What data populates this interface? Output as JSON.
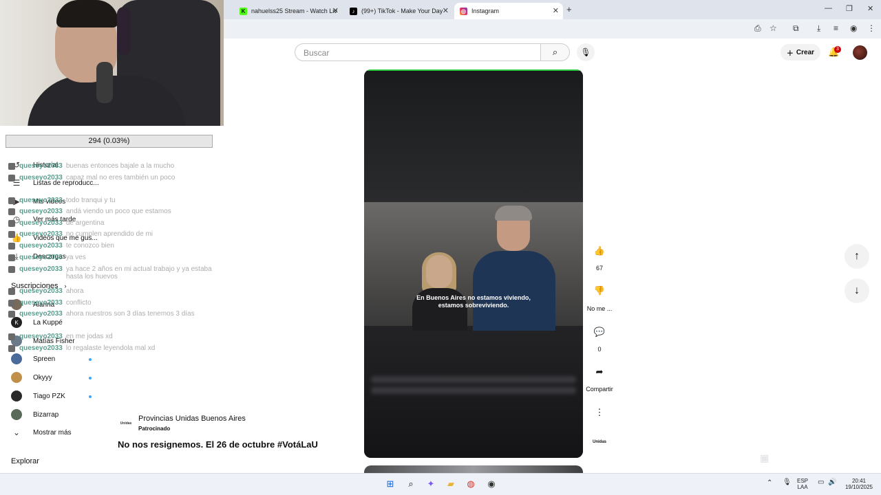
{
  "browser": {
    "tabs": [
      {
        "label": "nahuelss25 Stream - Watch Liv",
        "icon": "kick-icon",
        "color": "#53fc18"
      },
      {
        "label": "(99+) TikTok - Make Your Day",
        "icon": "tiktok-icon",
        "color": "#000000"
      },
      {
        "label": "Instagram",
        "icon": "instagram-icon",
        "color": "#e1306c"
      }
    ],
    "new_tab": "+"
  },
  "youtube": {
    "search_placeholder": "Buscar",
    "create_label": "Crear",
    "notifications_count": "3"
  },
  "stream_overlay": {
    "stat": "294 (0.03%)"
  },
  "sidebar": {
    "items": [
      {
        "label": "Historial",
        "icon": "history-icon"
      },
      {
        "label": "Listas de reproducc...",
        "icon": "playlist-icon"
      },
      {
        "label": "Mis videos",
        "icon": "video-icon"
      },
      {
        "label": "Ver más tarde",
        "icon": "clock-icon"
      },
      {
        "label": "Videos que me gus...",
        "icon": "thumbs-up-icon"
      },
      {
        "label": "Descargas",
        "icon": "download-icon"
      }
    ],
    "subscriptions_title": "Suscripciones",
    "channels": [
      {
        "label": "Alanna",
        "live": false,
        "color": "#7a6a5a"
      },
      {
        "label": "La Kuppé",
        "live": false,
        "color": "#222222"
      },
      {
        "label": "Matías Fisher",
        "live": false,
        "color": "#6a7a8a"
      },
      {
        "label": "Spreen",
        "live": true,
        "color": "#4a6a9a"
      },
      {
        "label": "Okyyy",
        "live": true,
        "color": "#c0904a"
      },
      {
        "label": "Tiago PZK",
        "live": true,
        "color": "#2a2a2a"
      },
      {
        "label": "Bizarrap",
        "live": false,
        "color": "#5a6a5a"
      }
    ],
    "show_more": "Mostrar más",
    "explore_title": "Explorar"
  },
  "chat": [
    {
      "user": "queseyo2033",
      "msg": "buenas entonces bajale a la mucho"
    },
    {
      "user": "queseyo2033",
      "msg": "capaz mal no eres también un poco"
    },
    {
      "user": "queseyo2033",
      "msg": "todo tranqui y tu"
    },
    {
      "user": "queseyo2033",
      "msg": "andá viendo un poco que estamos"
    },
    {
      "user": "queseyo2033",
      "msg": "de argentina"
    },
    {
      "user": "queseyo2033",
      "msg": "no cumplen aprendido de mi"
    },
    {
      "user": "queseyo2033",
      "msg": "te conozco bien"
    },
    {
      "user": "queseyo2033",
      "msg": "ya ves"
    },
    {
      "user": "queseyo2033",
      "msg": "ya hace 2 años en mi actual trabajo y ya estaba hasta los huevos"
    },
    {
      "user": "queseyo2033",
      "msg": "ahora"
    },
    {
      "user": "queseyo2033",
      "msg": "conflicto"
    },
    {
      "user": "queseyo2033",
      "msg": "ahora nuestros son 3 días tenemos 3 días"
    },
    {
      "user": "queseyo2033",
      "msg": "en me jodas xd"
    },
    {
      "user": "queseyo2033",
      "msg": "lo regalaste leyendola mal xd"
    }
  ],
  "short": {
    "subtitle_line1": "En Buenos Aires no estamos viviendo,",
    "subtitle_line2": "estamos sobreviviendo.",
    "likes": "67",
    "dislike_label": "No me ...",
    "comments": "0",
    "share_label": "Compartir"
  },
  "ad": {
    "logo_text": "Unidas",
    "channel": "Provincias Unidas Buenos Aires",
    "sponsored": "Patrocinado",
    "title": "No nos resignemos. El 26 de octubre #VotáLaU"
  },
  "taskbar": {
    "lang1": "ESP",
    "lang2": "LAA",
    "time": "20:41",
    "date": "19/10/2025"
  }
}
